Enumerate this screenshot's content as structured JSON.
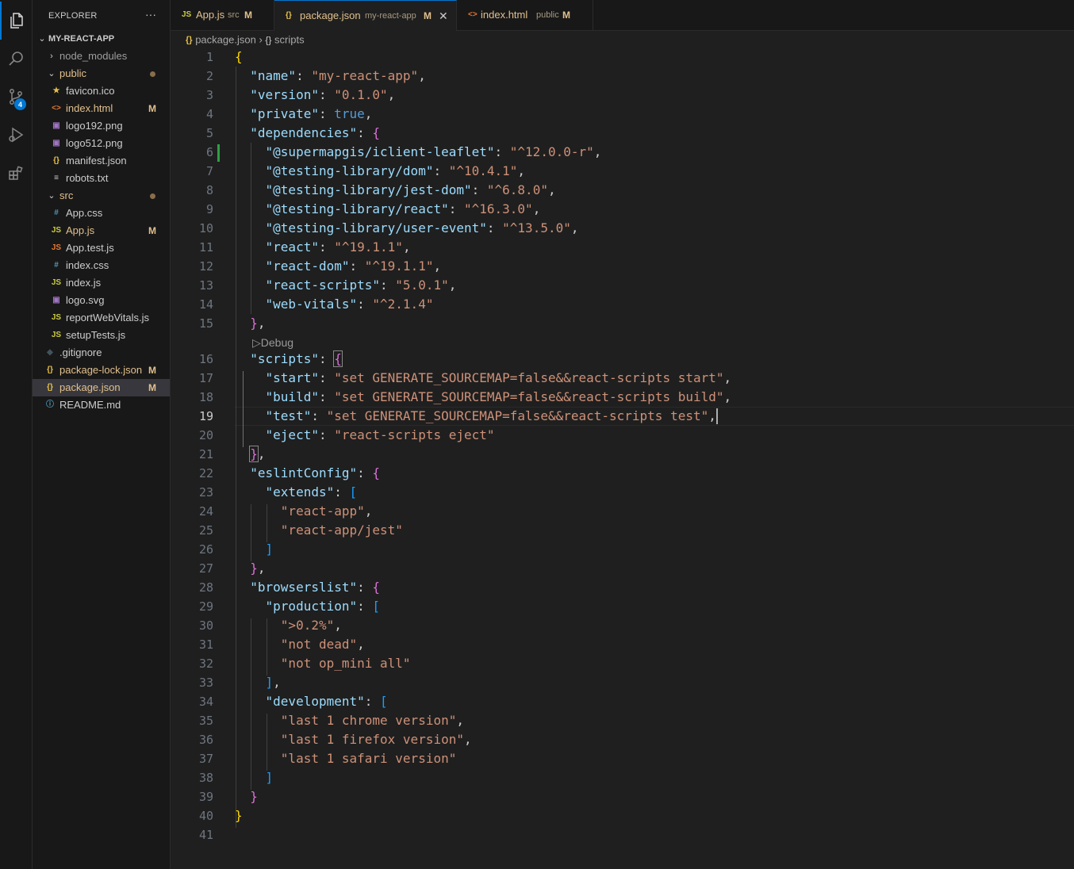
{
  "activity_bar": {
    "items": [
      {
        "name": "explorer",
        "icon": "files-icon",
        "active": true
      },
      {
        "name": "search",
        "icon": "search-icon"
      },
      {
        "name": "source-control",
        "icon": "source-control-icon",
        "badge": "4"
      },
      {
        "name": "run-and-debug",
        "icon": "run-debug-icon"
      },
      {
        "name": "extensions",
        "icon": "extensions-icon"
      }
    ]
  },
  "sidebar": {
    "title": "EXPLORER",
    "more_label": "···",
    "root_label": "MY-REACT-APP",
    "tree": [
      {
        "label": "node_modules",
        "type": "folder",
        "open": false,
        "depth": 1,
        "style": "dim"
      },
      {
        "label": "public",
        "type": "folder",
        "open": true,
        "depth": 1,
        "style": "mod",
        "dot": true
      },
      {
        "label": "favicon.ico",
        "type": "file",
        "depth": 2,
        "icon": "★",
        "icon_color": "#e8c14a",
        "style": "plain"
      },
      {
        "label": "index.html",
        "type": "file",
        "depth": 2,
        "icon": "<>",
        "icon_color": "#e37933",
        "style": "mod",
        "status": "M"
      },
      {
        "label": "logo192.png",
        "type": "file",
        "depth": 2,
        "icon": "▣",
        "icon_color": "#a074c4",
        "style": "plain"
      },
      {
        "label": "logo512.png",
        "type": "file",
        "depth": 2,
        "icon": "▣",
        "icon_color": "#a074c4",
        "style": "plain"
      },
      {
        "label": "manifest.json",
        "type": "file",
        "depth": 2,
        "icon": "{}",
        "icon_color": "#e8c14a",
        "style": "plain"
      },
      {
        "label": "robots.txt",
        "type": "file",
        "depth": 2,
        "icon": "≡",
        "icon_color": "#cccccc",
        "style": "plain"
      },
      {
        "label": "src",
        "type": "folder",
        "open": true,
        "depth": 1,
        "style": "mod",
        "dot": true
      },
      {
        "label": "App.css",
        "type": "file",
        "depth": 2,
        "icon": "#",
        "icon_color": "#519aba",
        "style": "plain"
      },
      {
        "label": "App.js",
        "type": "file",
        "depth": 2,
        "icon": "JS",
        "icon_color": "#cbcb41",
        "style": "mod",
        "status": "M"
      },
      {
        "label": "App.test.js",
        "type": "file",
        "depth": 2,
        "icon": "JS",
        "icon_color": "#e37933",
        "style": "plain"
      },
      {
        "label": "index.css",
        "type": "file",
        "depth": 2,
        "icon": "#",
        "icon_color": "#519aba",
        "style": "plain"
      },
      {
        "label": "index.js",
        "type": "file",
        "depth": 2,
        "icon": "JS",
        "icon_color": "#cbcb41",
        "style": "plain"
      },
      {
        "label": "logo.svg",
        "type": "file",
        "depth": 2,
        "icon": "▣",
        "icon_color": "#a074c4",
        "style": "plain"
      },
      {
        "label": "reportWebVitals.js",
        "type": "file",
        "depth": 2,
        "icon": "JS",
        "icon_color": "#cbcb41",
        "style": "plain"
      },
      {
        "label": "setupTests.js",
        "type": "file",
        "depth": 2,
        "icon": "JS",
        "icon_color": "#cbcb41",
        "style": "plain"
      },
      {
        "label": ".gitignore",
        "type": "file",
        "depth": 1,
        "icon": "◆",
        "icon_color": "#41535b",
        "style": "plain"
      },
      {
        "label": "package-lock.json",
        "type": "file",
        "depth": 1,
        "icon": "{}",
        "icon_color": "#e8c14a",
        "style": "mod",
        "status": "M"
      },
      {
        "label": "package.json",
        "type": "file",
        "depth": 1,
        "icon": "{}",
        "icon_color": "#e8c14a",
        "style": "mod",
        "status": "M",
        "selected": true
      },
      {
        "label": "README.md",
        "type": "file",
        "depth": 1,
        "icon": "ⓘ",
        "icon_color": "#519aba",
        "style": "plain"
      }
    ]
  },
  "tabs": [
    {
      "icon": "JS",
      "icon_color": "#cbcb41",
      "label": "App.js",
      "desc": "src",
      "status": "M",
      "active": false
    },
    {
      "icon": "{}",
      "icon_color": "#e8c14a",
      "label": "package.json",
      "desc": "my-react-app",
      "status": "M",
      "active": true,
      "close": "✕"
    },
    {
      "icon": "<>",
      "icon_color": "#e37933",
      "label": "index.html",
      "desc": "public",
      "status": "M",
      "active": false
    }
  ],
  "breadcrumb": {
    "file_icon": "{}",
    "file": "package.json",
    "separator": "›",
    "symbol_icon": "{}",
    "symbol": "scripts"
  },
  "editor": {
    "current_line": 19,
    "codelens": {
      "before_line": 16,
      "label": "Debug",
      "icon": "▷"
    },
    "lines": [
      {
        "n": "1",
        "tokens": [
          [
            "br1",
            "{"
          ]
        ]
      },
      {
        "n": "2",
        "tokens": [
          [
            "p",
            "  "
          ],
          [
            "k",
            "\"name\""
          ],
          [
            "p",
            ": "
          ],
          [
            "s",
            "\"my-react-app\""
          ],
          [
            "p",
            ","
          ]
        ]
      },
      {
        "n": "3",
        "tokens": [
          [
            "p",
            "  "
          ],
          [
            "k",
            "\"version\""
          ],
          [
            "p",
            ": "
          ],
          [
            "s",
            "\"0.1.0\""
          ],
          [
            "p",
            ","
          ]
        ]
      },
      {
        "n": "4",
        "tokens": [
          [
            "p",
            "  "
          ],
          [
            "k",
            "\"private\""
          ],
          [
            "p",
            ": "
          ],
          [
            "b",
            "true"
          ],
          [
            "p",
            ","
          ]
        ]
      },
      {
        "n": "5",
        "tokens": [
          [
            "p",
            "  "
          ],
          [
            "k",
            "\"dependencies\""
          ],
          [
            "p",
            ": "
          ],
          [
            "br2",
            "{"
          ]
        ]
      },
      {
        "n": "6",
        "tokens": [
          [
            "p",
            "    "
          ],
          [
            "k",
            "\"@supermapgis/iclient-leaflet\""
          ],
          [
            "p",
            ": "
          ],
          [
            "s",
            "\"^12.0.0-r\""
          ],
          [
            "p",
            ","
          ]
        ]
      },
      {
        "n": "7",
        "tokens": [
          [
            "p",
            "    "
          ],
          [
            "k",
            "\"@testing-library/dom\""
          ],
          [
            "p",
            ": "
          ],
          [
            "s",
            "\"^10.4.1\""
          ],
          [
            "p",
            ","
          ]
        ]
      },
      {
        "n": "8",
        "tokens": [
          [
            "p",
            "    "
          ],
          [
            "k",
            "\"@testing-library/jest-dom\""
          ],
          [
            "p",
            ": "
          ],
          [
            "s",
            "\"^6.8.0\""
          ],
          [
            "p",
            ","
          ]
        ]
      },
      {
        "n": "9",
        "tokens": [
          [
            "p",
            "    "
          ],
          [
            "k",
            "\"@testing-library/react\""
          ],
          [
            "p",
            ": "
          ],
          [
            "s",
            "\"^16.3.0\""
          ],
          [
            "p",
            ","
          ]
        ]
      },
      {
        "n": "10",
        "tokens": [
          [
            "p",
            "    "
          ],
          [
            "k",
            "\"@testing-library/user-event\""
          ],
          [
            "p",
            ": "
          ],
          [
            "s",
            "\"^13.5.0\""
          ],
          [
            "p",
            ","
          ]
        ]
      },
      {
        "n": "11",
        "tokens": [
          [
            "p",
            "    "
          ],
          [
            "k",
            "\"react\""
          ],
          [
            "p",
            ": "
          ],
          [
            "s",
            "\"^19.1.1\""
          ],
          [
            "p",
            ","
          ]
        ]
      },
      {
        "n": "12",
        "tokens": [
          [
            "p",
            "    "
          ],
          [
            "k",
            "\"react-dom\""
          ],
          [
            "p",
            ": "
          ],
          [
            "s",
            "\"^19.1.1\""
          ],
          [
            "p",
            ","
          ]
        ]
      },
      {
        "n": "13",
        "tokens": [
          [
            "p",
            "    "
          ],
          [
            "k",
            "\"react-scripts\""
          ],
          [
            "p",
            ": "
          ],
          [
            "s",
            "\"5.0.1\""
          ],
          [
            "p",
            ","
          ]
        ]
      },
      {
        "n": "14",
        "tokens": [
          [
            "p",
            "    "
          ],
          [
            "k",
            "\"web-vitals\""
          ],
          [
            "p",
            ": "
          ],
          [
            "s",
            "\"^2.1.4\""
          ]
        ]
      },
      {
        "n": "15",
        "tokens": [
          [
            "p",
            "  "
          ],
          [
            "br2",
            "}"
          ],
          [
            "p",
            ","
          ]
        ]
      },
      {
        "n": "16",
        "tokens": [
          [
            "p",
            "  "
          ],
          [
            "k",
            "\"scripts\""
          ],
          [
            "p",
            ": "
          ],
          [
            "br2 box",
            "{"
          ]
        ]
      },
      {
        "n": "17",
        "tokens": [
          [
            "p",
            "    "
          ],
          [
            "k",
            "\"start\""
          ],
          [
            "p",
            ": "
          ],
          [
            "s",
            "\"set GENERATE_SOURCEMAP=false&&react-scripts start\""
          ],
          [
            "p",
            ","
          ]
        ]
      },
      {
        "n": "18",
        "tokens": [
          [
            "p",
            "    "
          ],
          [
            "k",
            "\"build\""
          ],
          [
            "p",
            ": "
          ],
          [
            "s",
            "\"set GENERATE_SOURCEMAP=false&&react-scripts build\""
          ],
          [
            "p",
            ","
          ]
        ]
      },
      {
        "n": "19",
        "tokens": [
          [
            "p",
            "    "
          ],
          [
            "k",
            "\"test\""
          ],
          [
            "p",
            ": "
          ],
          [
            "s",
            "\"set GENERATE_SOURCEMAP=false&&react-scripts test\""
          ],
          [
            "p",
            ","
          ]
        ]
      },
      {
        "n": "20",
        "tokens": [
          [
            "p",
            "    "
          ],
          [
            "k",
            "\"eject\""
          ],
          [
            "p",
            ": "
          ],
          [
            "s",
            "\"react-scripts eject\""
          ]
        ]
      },
      {
        "n": "21",
        "tokens": [
          [
            "p",
            "  "
          ],
          [
            "br2 box",
            "}"
          ],
          [
            "p",
            ","
          ]
        ]
      },
      {
        "n": "22",
        "tokens": [
          [
            "p",
            "  "
          ],
          [
            "k",
            "\"eslintConfig\""
          ],
          [
            "p",
            ": "
          ],
          [
            "br2",
            "{"
          ]
        ]
      },
      {
        "n": "23",
        "tokens": [
          [
            "p",
            "    "
          ],
          [
            "k",
            "\"extends\""
          ],
          [
            "p",
            ": "
          ],
          [
            "br3",
            "["
          ]
        ]
      },
      {
        "n": "24",
        "tokens": [
          [
            "p",
            "      "
          ],
          [
            "s",
            "\"react-app\""
          ],
          [
            "p",
            ","
          ]
        ]
      },
      {
        "n": "25",
        "tokens": [
          [
            "p",
            "      "
          ],
          [
            "s",
            "\"react-app/jest\""
          ]
        ]
      },
      {
        "n": "26",
        "tokens": [
          [
            "p",
            "    "
          ],
          [
            "br3",
            "]"
          ]
        ]
      },
      {
        "n": "27",
        "tokens": [
          [
            "p",
            "  "
          ],
          [
            "br2",
            "}"
          ],
          [
            "p",
            ","
          ]
        ]
      },
      {
        "n": "28",
        "tokens": [
          [
            "p",
            "  "
          ],
          [
            "k",
            "\"browserslist\""
          ],
          [
            "p",
            ": "
          ],
          [
            "br2",
            "{"
          ]
        ]
      },
      {
        "n": "29",
        "tokens": [
          [
            "p",
            "    "
          ],
          [
            "k",
            "\"production\""
          ],
          [
            "p",
            ": "
          ],
          [
            "br3",
            "["
          ]
        ]
      },
      {
        "n": "30",
        "tokens": [
          [
            "p",
            "      "
          ],
          [
            "s",
            "\">0.2%\""
          ],
          [
            "p",
            ","
          ]
        ]
      },
      {
        "n": "31",
        "tokens": [
          [
            "p",
            "      "
          ],
          [
            "s",
            "\"not dead\""
          ],
          [
            "p",
            ","
          ]
        ]
      },
      {
        "n": "32",
        "tokens": [
          [
            "p",
            "      "
          ],
          [
            "s",
            "\"not op_mini all\""
          ]
        ]
      },
      {
        "n": "33",
        "tokens": [
          [
            "p",
            "    "
          ],
          [
            "br3",
            "]"
          ],
          [
            "p",
            ","
          ]
        ]
      },
      {
        "n": "34",
        "tokens": [
          [
            "p",
            "    "
          ],
          [
            "k",
            "\"development\""
          ],
          [
            "p",
            ": "
          ],
          [
            "br3",
            "["
          ]
        ]
      },
      {
        "n": "35",
        "tokens": [
          [
            "p",
            "      "
          ],
          [
            "s",
            "\"last 1 chrome version\""
          ],
          [
            "p",
            ","
          ]
        ]
      },
      {
        "n": "36",
        "tokens": [
          [
            "p",
            "      "
          ],
          [
            "s",
            "\"last 1 firefox version\""
          ],
          [
            "p",
            ","
          ]
        ]
      },
      {
        "n": "37",
        "tokens": [
          [
            "p",
            "      "
          ],
          [
            "s",
            "\"last 1 safari version\""
          ]
        ]
      },
      {
        "n": "38",
        "tokens": [
          [
            "p",
            "    "
          ],
          [
            "br3",
            "]"
          ]
        ]
      },
      {
        "n": "39",
        "tokens": [
          [
            "p",
            "  "
          ],
          [
            "br2",
            "}"
          ]
        ]
      },
      {
        "n": "40",
        "tokens": [
          [
            "br1",
            "}"
          ]
        ]
      },
      {
        "n": "41",
        "tokens": []
      }
    ]
  },
  "colors": {
    "accent": "#0078d4",
    "modified": "#e2c08d",
    "added_marker": "#2ea043"
  }
}
